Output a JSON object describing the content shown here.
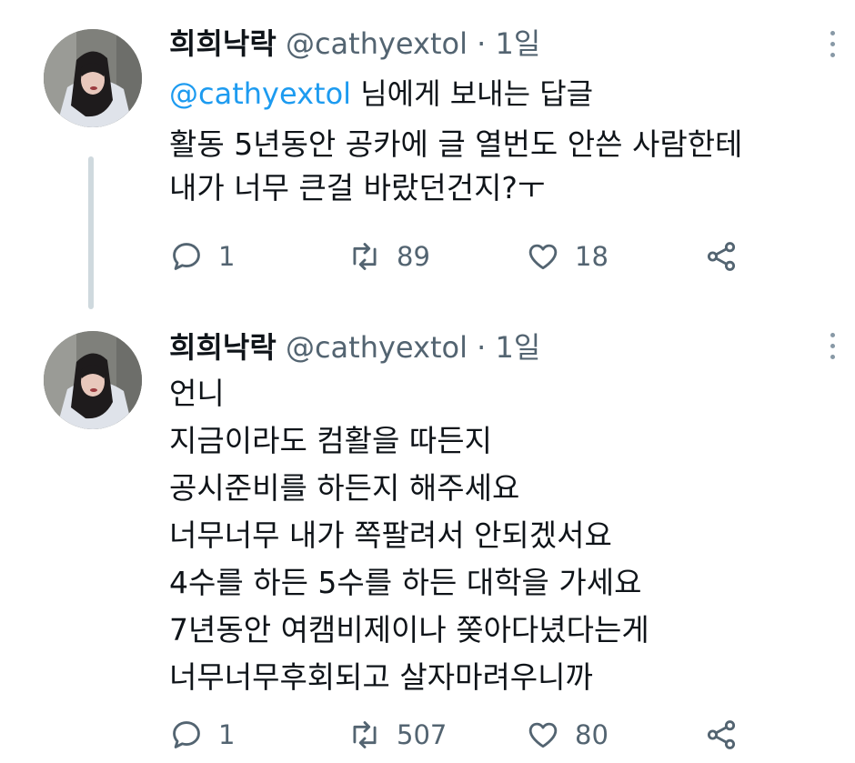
{
  "tweets": [
    {
      "author_name": "희희낙락",
      "handle": "@cathyextol",
      "separator": "·",
      "time": "1일",
      "replying_to_handle": "@cathyextol",
      "replying_suffix": " 님에게 보내는 답글",
      "lines": [
        "활동 5년동안 공카에 글 열번도 안쓴 사람한테",
        "내가 너무 큰걸 바랐던건지?ㅜ"
      ],
      "replies": "1",
      "retweets": "89",
      "likes": "18"
    },
    {
      "author_name": "희희낙락",
      "handle": "@cathyextol",
      "separator": "·",
      "time": "1일",
      "lines": [
        "언니",
        "지금이라도 컴활을 따든지",
        "공시준비를 하든지 해주세요",
        "너무너무 내가 쪽팔려서 안되겠서요",
        "4수를 하든 5수를 하든 대학을 가세요",
        "7년동안 여캠비제이나 쫒아다녔다는게",
        "너무너무후회되고 살자마려우니까"
      ],
      "replies": "1",
      "retweets": "507",
      "likes": "80"
    }
  ],
  "icons": {
    "reply": "reply-icon",
    "retweet": "retweet-icon",
    "like": "heart-icon",
    "share": "share-icon",
    "more": "more-icon"
  },
  "colors": {
    "link": "#1d9bf0",
    "muted": "#536471",
    "thread_line": "#cfd9de"
  }
}
